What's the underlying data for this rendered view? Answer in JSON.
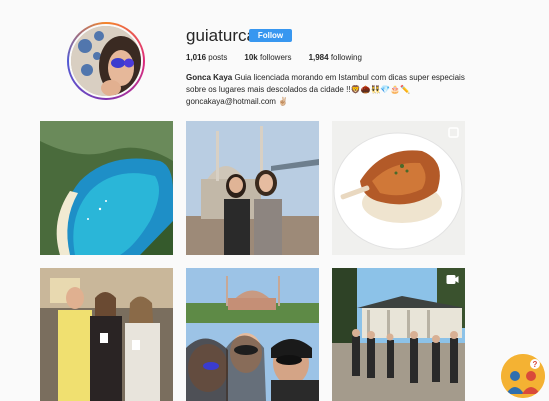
{
  "profile": {
    "username": "guiaturca",
    "follow_label": "Follow",
    "posts_count": "1,016",
    "posts_label": "posts",
    "followers_count": "10k",
    "followers_label": "followers",
    "following_count": "1,984",
    "following_label": "following",
    "full_name": "Gonca Kaya",
    "bio_line1": "Guia licenciada morando em Istambul com dicas super especiais",
    "bio_line2": "sobre os lugares mais descolados da cidade !!🦁🌰👯💎🎂✏️",
    "email": "goncakaya@hotmail.com ✌🏼"
  },
  "grid": {
    "posts": [
      {
        "subject": "turquoise bay beach"
      },
      {
        "subject": "two women at mosque square"
      },
      {
        "subject": "plated meat dish"
      },
      {
        "subject": "group holding drinks"
      },
      {
        "subject": "selfie at Hagia Sophia"
      },
      {
        "subject": "people at pavilion"
      }
    ]
  },
  "colors": {
    "follow_button": "#3897f0",
    "background": "#fafafa",
    "text": "#262626"
  }
}
